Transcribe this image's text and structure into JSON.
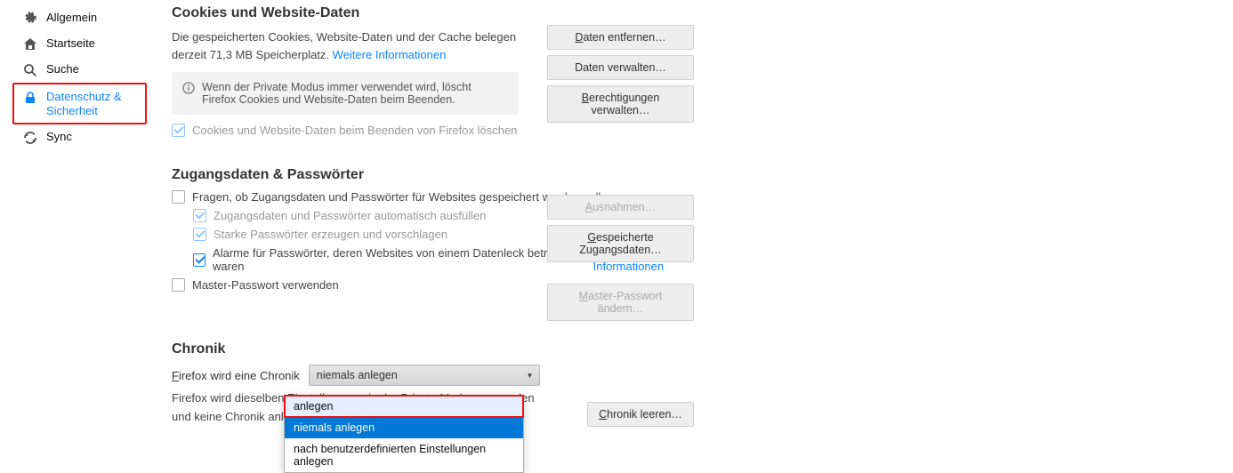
{
  "sidebar": {
    "items": [
      {
        "label": "Allgemein"
      },
      {
        "label": "Startseite"
      },
      {
        "label": "Suche"
      },
      {
        "label": "Datenschutz & Sicherheit"
      },
      {
        "label": "Sync"
      }
    ]
  },
  "cookies": {
    "title": "Cookies und Website-Daten",
    "desc_a": "Die gespeicherten Cookies, Website-Daten und der Cache belegen derzeit 71,3 MB Speicherplatz.",
    "more_info": "Weitere Informationen",
    "info_box": "Wenn der Private Modus immer verwendet wird, löscht Firefox Cookies und Website-Daten beim Beenden.",
    "delete_cb": "Cookies und Website-Daten beim Beenden von Firefox löschen",
    "buttons": {
      "remove": "Daten entfernen…",
      "manage": "Daten verwalten…",
      "perms": "Berechtigungen verwalten…"
    }
  },
  "logins": {
    "title": "Zugangsdaten & Passwörter",
    "ask": "Fragen, ob Zugangsdaten und Passwörter für Websites gespeichert werden sollen",
    "autofill": "Zugangsdaten und Passwörter automatisch ausfüllen",
    "strong": "Starke Passwörter erzeugen und vorschlagen",
    "breach": "Alarme für Passwörter, deren Websites von einem Datenleck betroffen waren",
    "more_info": "Weitere Informationen",
    "master": "Master-Passwort verwenden",
    "buttons": {
      "exceptions": "Ausnahmen…",
      "saved": "Gespeicherte Zugangsdaten…",
      "master": "Master-Passwort ändern…"
    }
  },
  "chronik": {
    "title": "Chronik",
    "label": "Firefox wird eine Chronik",
    "selected": "niemals anlegen",
    "options": [
      "anlegen",
      "niemals anlegen",
      "nach benutzerdefinierten Einstellungen anlegen"
    ],
    "desc": "Firefox wird dieselben Einstellungen wie der Private Modus verwenden und keine Chronik anlegen, während Sie Firefox verwenden.",
    "clear": "Chronik leeren…"
  }
}
